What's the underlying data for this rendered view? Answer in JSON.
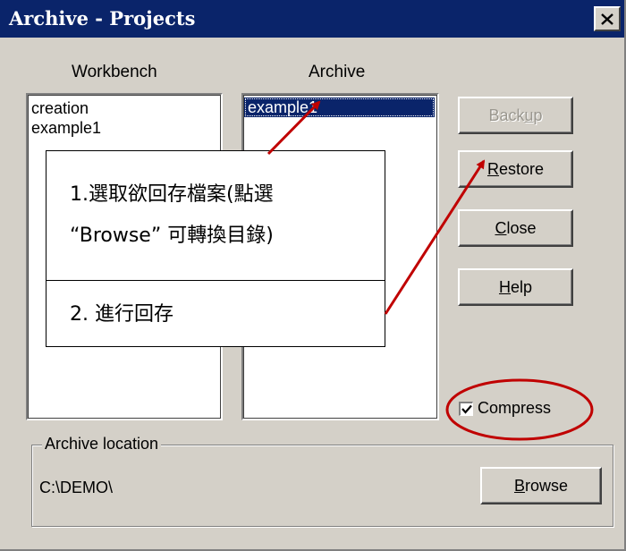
{
  "window": {
    "title": "Archive - Projects"
  },
  "workbench": {
    "label": "Workbench",
    "items": [
      "creation",
      "example1"
    ]
  },
  "archive": {
    "label": "Archive",
    "items": [
      "example1"
    ],
    "selected": "example1"
  },
  "buttons": {
    "backup": {
      "pre": "Back",
      "key": "u",
      "post": "p",
      "enabled": false
    },
    "restore": {
      "pre": "",
      "key": "R",
      "post": "estore",
      "enabled": true
    },
    "close": {
      "pre": "",
      "key": "C",
      "post": "lose",
      "enabled": true
    },
    "help": {
      "pre": "",
      "key": "H",
      "post": "elp",
      "enabled": true
    },
    "browse": {
      "pre": "",
      "key": "B",
      "post": "rowse",
      "enabled": true
    }
  },
  "compress": {
    "label": "Compress",
    "checked": true
  },
  "location": {
    "legend": "Archive location",
    "path": "C:\\DEMO\\"
  },
  "annotation": {
    "step1_line1": "1.選取欲回存檔案(點選",
    "step1_line2": "“Browse” 可轉換目錄)",
    "step2": "2. 進行回存",
    "arrow_color": "#c00000"
  },
  "colors": {
    "titlebar": "#0a246a",
    "face": "#d4d0c8",
    "selection": "#0a246a"
  }
}
